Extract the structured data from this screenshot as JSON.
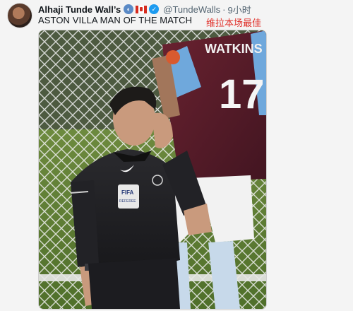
{
  "tweet": {
    "author_name": "Alhaji Tunde Wall’s",
    "handle": "@TundeWalls",
    "separator": "·",
    "time": "9小时",
    "text": "ASTON VILLA MAN OF THE MATCH",
    "translation_label": "维拉本场最佳",
    "badges": [
      "globe-icon",
      "canada-flag-icon",
      "verified-badge-icon"
    ]
  },
  "media": {
    "player_name": "WATKINS",
    "player_number": "17",
    "patch_text": "FIFA",
    "patch_subtext": "REFEREE"
  },
  "colors": {
    "translate_red": "#e0302a",
    "muted": "#536471",
    "verified": "#1d9bf0",
    "maroon_shirt": "#5b1f2b",
    "sky_blue": "#6fa8dc"
  }
}
